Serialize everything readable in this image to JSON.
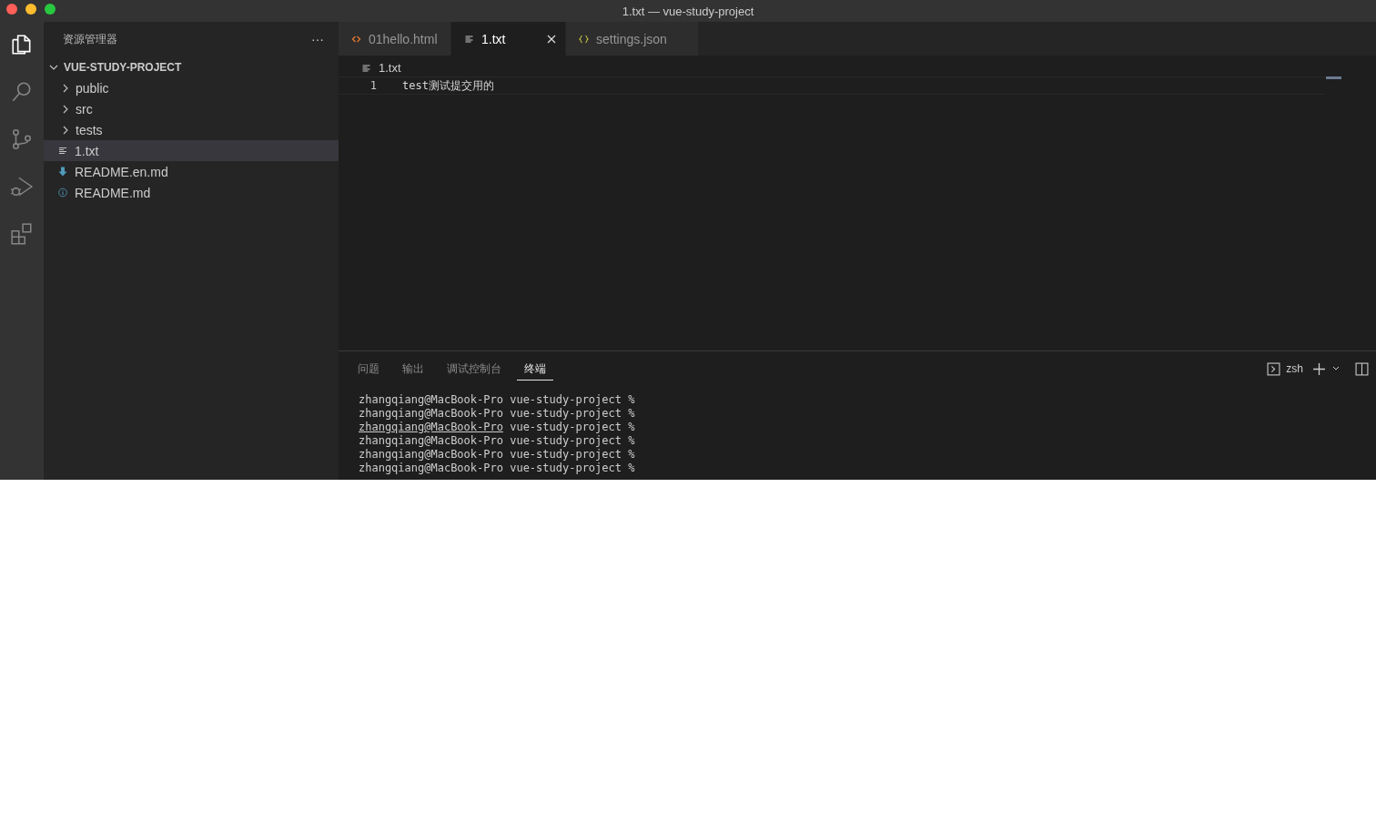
{
  "window": {
    "title": "1.txt — vue-study-project"
  },
  "activity_bar": [
    {
      "kind": "files",
      "selected": true
    },
    {
      "kind": "search",
      "selected": false
    },
    {
      "kind": "scm",
      "selected": false
    },
    {
      "kind": "debug",
      "selected": false
    },
    {
      "kind": "extensions",
      "selected": false
    }
  ],
  "sidebar": {
    "title": "资源管理器",
    "more": "···",
    "root": {
      "label": "VUE-STUDY-PROJECT",
      "expanded": true,
      "children": [
        {
          "label": "public",
          "kind": "folder",
          "expanded": false,
          "selected": false
        },
        {
          "label": "src",
          "kind": "folder",
          "expanded": false,
          "selected": false
        },
        {
          "label": "tests",
          "kind": "folder",
          "expanded": false,
          "selected": false
        },
        {
          "label": "1.txt",
          "kind": "text",
          "selected": true
        },
        {
          "label": "README.en.md",
          "kind": "download",
          "selected": false
        },
        {
          "label": "README.md",
          "kind": "info",
          "selected": false
        }
      ]
    }
  },
  "tabs": [
    {
      "label": "01hello.html",
      "kind": "html",
      "selected": false
    },
    {
      "label": "1.txt",
      "kind": "text",
      "selected": true
    },
    {
      "label": "settings.json",
      "kind": "json",
      "selected": false
    }
  ],
  "breadcrumb": "1.txt",
  "editor": {
    "lines": [
      {
        "number": "1",
        "text": "test测试提交用的"
      }
    ]
  },
  "panel": {
    "tabs": [
      {
        "label": "问题",
        "selected": false
      },
      {
        "label": "输出",
        "selected": false
      },
      {
        "label": "调试控制台",
        "selected": false
      },
      {
        "label": "终端",
        "selected": true
      }
    ],
    "shell": "zsh",
    "terminal": [
      {
        "user": "zhangqiang@MacBook-Pro",
        "rest": "vue-study-project %",
        "hovered": false
      },
      {
        "user": "zhangqiang@MacBook-Pro",
        "rest": "vue-study-project %",
        "hovered": false
      },
      {
        "user": "zhangqiang@MacBook-Pro",
        "rest": "vue-study-project %",
        "hovered": true
      },
      {
        "user": "zhangqiang@MacBook-Pro",
        "rest": "vue-study-project %",
        "hovered": false
      },
      {
        "user": "zhangqiang@MacBook-Pro",
        "rest": "vue-study-project %",
        "hovered": false
      },
      {
        "user": "zhangqiang@MacBook-Pro",
        "rest": "vue-study-project %",
        "hovered": false
      }
    ]
  }
}
